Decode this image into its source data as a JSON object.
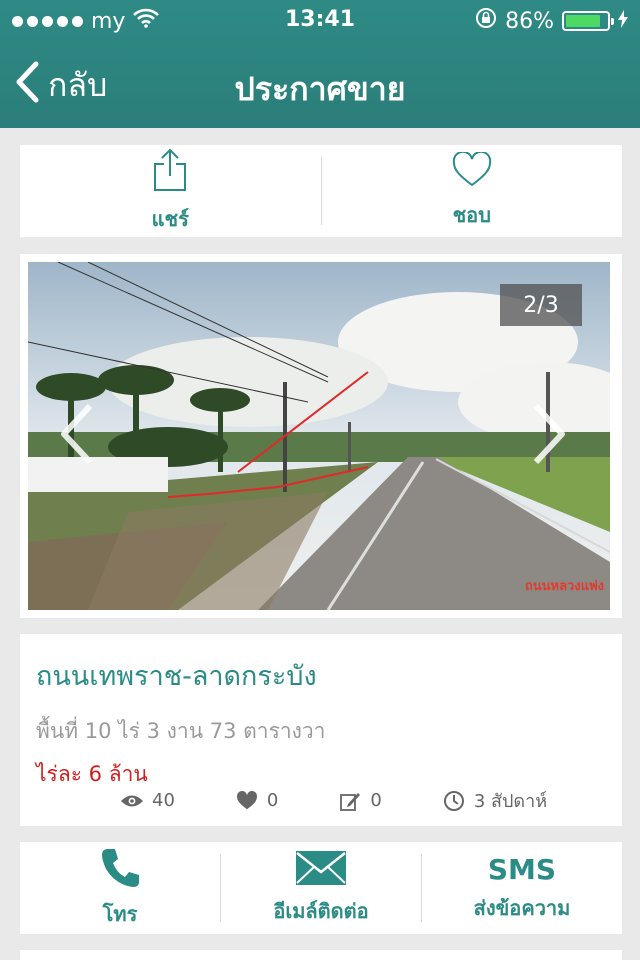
{
  "status_bar": {
    "carrier": "my",
    "time": "13:41",
    "battery_percent": "86%",
    "battery_level": 0.86
  },
  "nav": {
    "back_label": "กลับ",
    "title": "ประกาศขาย"
  },
  "actions": {
    "share_label": "แชร์",
    "like_label": "ชอบ"
  },
  "gallery": {
    "counter": "2/3",
    "watermark": "ถนนหลวงแพ่ง"
  },
  "listing": {
    "title": "ถนนเทพราช-ลาดกระบัง",
    "area": "พื้นที่ 10 ไร่ 3 งาน 73 ตารางวา",
    "price": "ไร่ละ 6 ล้าน",
    "views": "40",
    "likes": "0",
    "edits": "0",
    "posted": "3 สัปดาห์"
  },
  "contact": {
    "call_label": "โทร",
    "email_label": "อีเมล์ติดต่อ",
    "sms_word": "SMS",
    "sms_label": "ส่งข้อความ"
  },
  "colors": {
    "header": "#2b7e79",
    "accent": "#2b8c86",
    "price": "#d41c1c",
    "background": "#e9e9e9"
  }
}
